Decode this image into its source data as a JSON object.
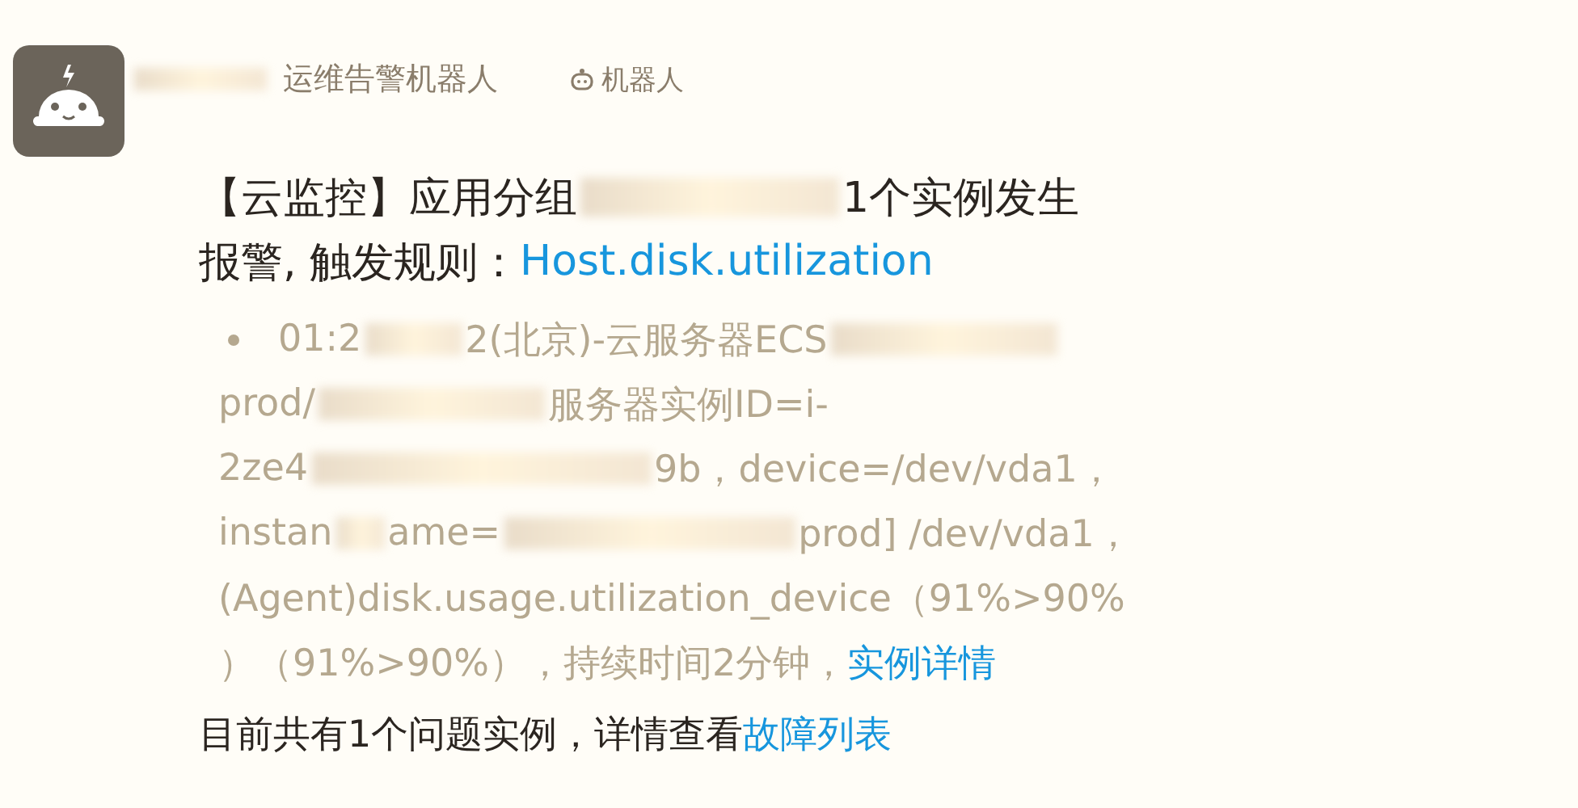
{
  "sender": {
    "name": "运维告警机器人",
    "badge": "机器人"
  },
  "title_lines": [
    [
      {
        "kind": "text",
        "text": "【云监控】应用分组"
      },
      {
        "kind": "redacted"
      },
      {
        "kind": "text",
        "text": "1个实例发生"
      }
    ],
    [
      {
        "kind": "text",
        "text": "报警, 触发规则："
      },
      {
        "kind": "link",
        "text": "Host.disk.utilization"
      }
    ]
  ],
  "detail_lines": [
    [
      {
        "kind": "text",
        "text": "01:2"
      },
      {
        "kind": "redacted"
      },
      {
        "kind": "text",
        "text": "2(北京)-云服务器ECS"
      },
      {
        "kind": "redacted"
      }
    ],
    [
      {
        "kind": "text",
        "text": "prod/"
      },
      {
        "kind": "redacted"
      },
      {
        "kind": "text",
        "text": "服务器实例ID=i-"
      }
    ],
    [
      {
        "kind": "text",
        "text": "2ze4"
      },
      {
        "kind": "redacted"
      },
      {
        "kind": "text",
        "text": "9b，device=/dev/vda1，"
      }
    ],
    [
      {
        "kind": "text",
        "text": "instan"
      },
      {
        "kind": "redacted"
      },
      {
        "kind": "text",
        "text": "ame="
      },
      {
        "kind": "redacted"
      },
      {
        "kind": "text",
        "text": "prod] /dev/vda1，"
      }
    ],
    [
      {
        "kind": "text",
        "text": "(Agent)disk.usage.utilization_device（91%>90%"
      }
    ],
    [
      {
        "kind": "text",
        "text": "）（91%>90%），持续时间2分钟，"
      },
      {
        "kind": "link",
        "text": "实例详情"
      }
    ]
  ],
  "footer": [
    {
      "kind": "text",
      "text": "目前共有1个问题实例，详情查看"
    },
    {
      "kind": "link",
      "text": "故障列表"
    }
  ]
}
